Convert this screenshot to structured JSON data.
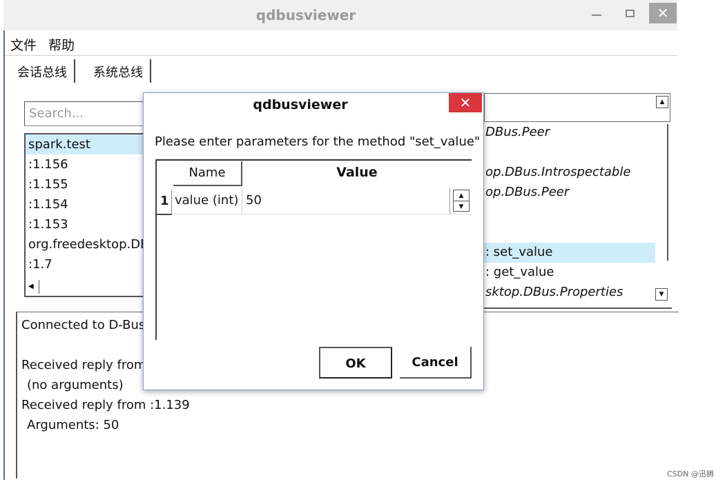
{
  "window": {
    "title": "qdbusviewer",
    "close_glyph": "✕"
  },
  "menubar": {
    "items": [
      {
        "label": "文件"
      },
      {
        "label": "帮助"
      }
    ]
  },
  "tabs": [
    {
      "label": "会话总线",
      "active": true
    },
    {
      "label": "系统总线",
      "active": false
    }
  ],
  "service_panel": {
    "search_placeholder": "Search...",
    "services": [
      {
        "label": "spark.test",
        "selected": true
      },
      {
        "label": ":1.156"
      },
      {
        "label": ":1.155"
      },
      {
        "label": ":1.154"
      },
      {
        "label": ":1.153"
      },
      {
        "label": "org.freedesktop.DB"
      },
      {
        "label": ":1.7"
      }
    ]
  },
  "interface_tree": {
    "rows": [
      {
        "label": "DBus.Peer",
        "italic": true
      },
      {
        "label": "op.DBus.Introspectable",
        "italic": true
      },
      {
        "label": "op.DBus.Peer",
        "italic": true
      },
      {
        "label": ": set_value",
        "selected": true
      },
      {
        "label": ": get_value"
      },
      {
        "label": "sktop.DBus.Properties",
        "italic": true
      }
    ]
  },
  "log": {
    "lines": [
      {
        "text": "Connected to D-Bus."
      },
      {
        "text": ""
      },
      {
        "text": "Received reply from"
      },
      {
        "text": "(no arguments)"
      },
      {
        "text": "Received reply from :1.139"
      },
      {
        "text": "Arguments: 50"
      }
    ]
  },
  "dialog": {
    "title": "qdbusviewer",
    "close_glyph": "✕",
    "prompt": "Please enter parameters for the method \"set_value\"",
    "table": {
      "columns": [
        "Name",
        "Value"
      ],
      "rows": [
        {
          "row_header": "1",
          "name": "value (int)",
          "value": "50"
        }
      ]
    },
    "ok_label": "OK",
    "cancel_label": "Cancel"
  },
  "watermark": "CSDN @迅狮",
  "colors": {
    "selection": "#cfecf9",
    "dialog_close": "#d9363e",
    "main_close": "#a4a4a4"
  },
  "icons": {
    "minimize": "minimize-icon",
    "maximize": "maximize-icon",
    "close": "close-icon",
    "scroll_up": "scroll-up-arrow-icon",
    "scroll_down": "scroll-down-arrow-icon",
    "scroll_left": "scroll-left-arrow-icon"
  }
}
